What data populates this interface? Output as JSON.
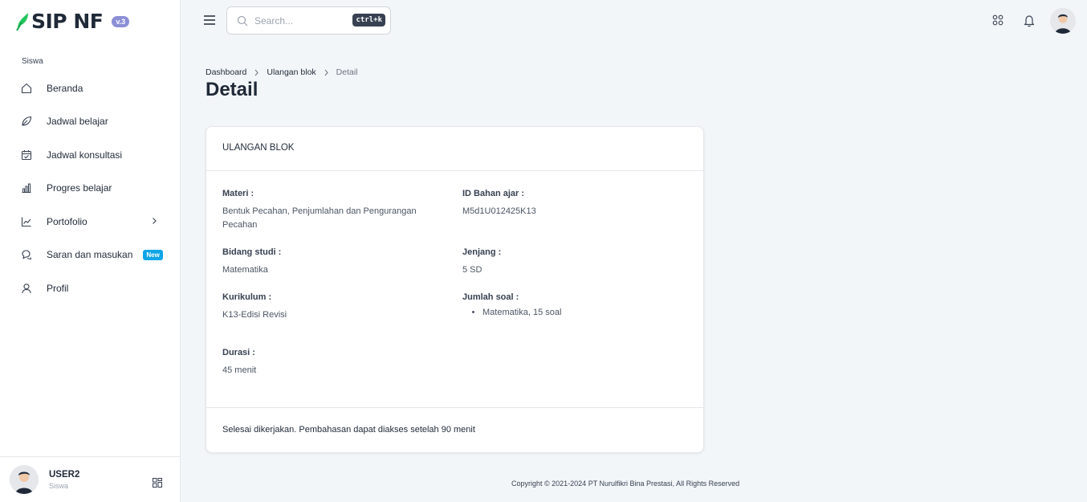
{
  "app": {
    "brand": "SIP NF",
    "version": "v.3"
  },
  "sidebar": {
    "section_label": "Siswa",
    "items": [
      {
        "label": "Beranda",
        "icon": "home-icon"
      },
      {
        "label": "Jadwal belajar",
        "icon": "leaf-icon"
      },
      {
        "label": "Jadwal konsultasi",
        "icon": "calendar-check-icon"
      },
      {
        "label": "Progres belajar",
        "icon": "bar-chart-icon"
      },
      {
        "label": "Portofolio",
        "icon": "trend-chart-icon",
        "has_submenu": true
      },
      {
        "label": "Saran dan masukan",
        "icon": "chat-icon",
        "badge": "New"
      },
      {
        "label": "Profil",
        "icon": "user-icon"
      }
    ],
    "user": {
      "name": "USER2",
      "role": "Siswa"
    }
  },
  "header": {
    "search_placeholder": "Search...",
    "search_shortcut": "ctrl+k"
  },
  "breadcrumb": {
    "items": [
      "Dashboard",
      "Ulangan blok"
    ],
    "current": "Detail"
  },
  "page_title": "Detail",
  "card": {
    "title": "ULANGAN BLOK",
    "fields": {
      "materi": {
        "label": "Materi :",
        "value": "Bentuk Pecahan, Penjumlahan dan Pengurangan Pecahan"
      },
      "id_bahan_ajar": {
        "label": "ID Bahan ajar :",
        "value": "M5d1U012425K13"
      },
      "bidang_studi": {
        "label": "Bidang studi :",
        "value": "Matematika"
      },
      "jenjang": {
        "label": "Jenjang :",
        "value": "5 SD"
      },
      "kurikulum": {
        "label": "Kurikulum :",
        "value": "K13-Edisi Revisi"
      },
      "jumlah_soal": {
        "label": "Jumlah soal :",
        "items": [
          "Matematika, 15 soal"
        ]
      },
      "durasi": {
        "label": "Durasi :",
        "value": "45 menit"
      }
    },
    "footer_text": "Selesai dikerjakan. Pembahasan dapat diakses setelah 90 menit"
  },
  "footer": {
    "copyright": "Copyright © 2021-2024 PT Nurulfikri Bina Prestasi, All Rights Reserved"
  },
  "colors": {
    "brand_green": "#22c55e",
    "version_badge": "#8b8fd6",
    "new_badge": "#0ea5e9",
    "background": "#f3f6f9"
  }
}
